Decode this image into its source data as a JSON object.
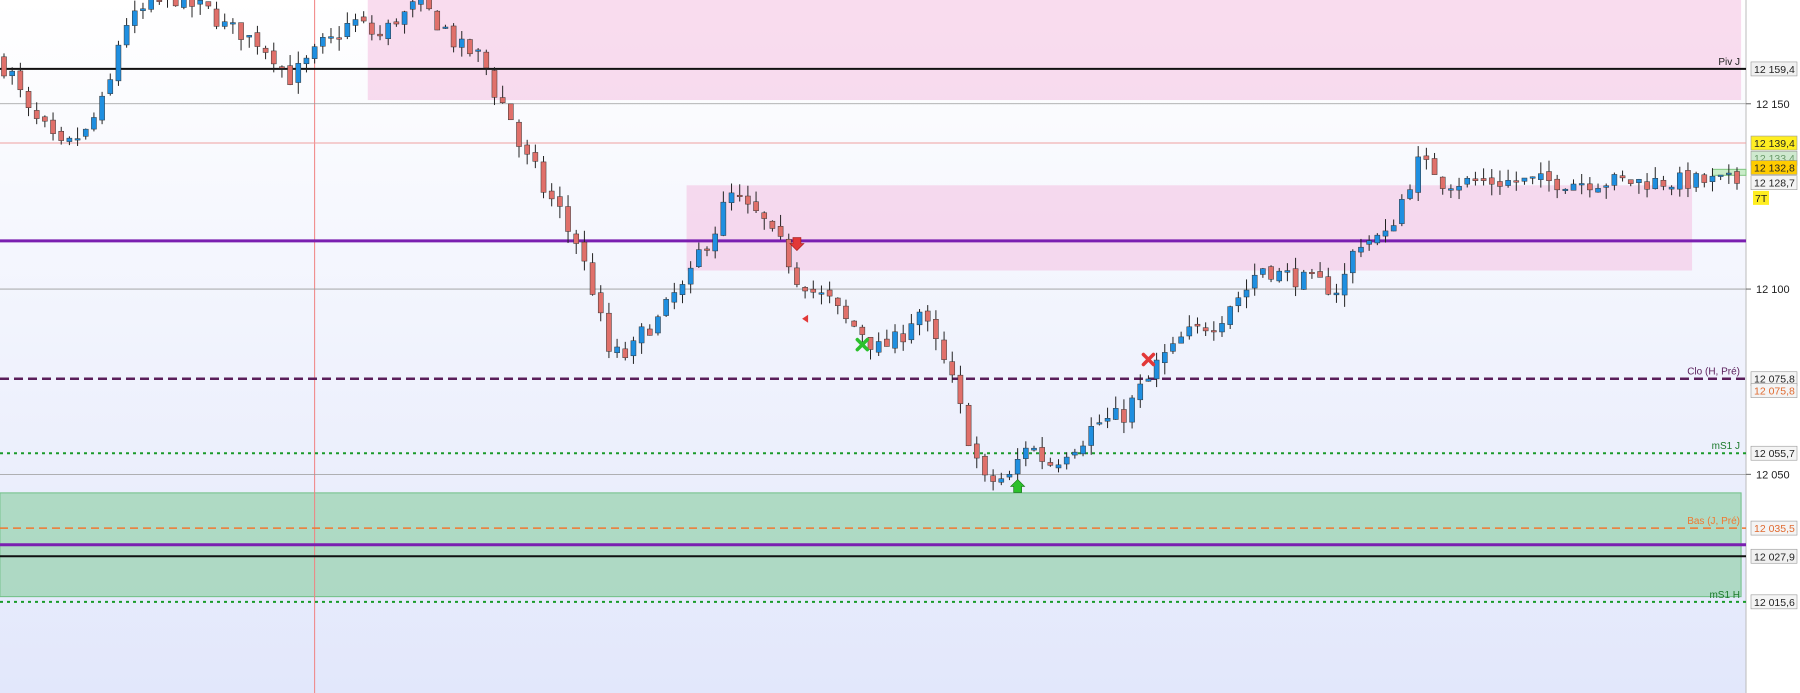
{
  "chart_data": {
    "type": "candlestick",
    "instrument_note": "",
    "y_range": [
      11991,
      12178
    ],
    "y_ticks": [
      12150,
      12100,
      12050
    ],
    "x_count": 213,
    "colors": {
      "up": "#1f8fe0",
      "down": "#e0706a",
      "pink_zone": "#f4bfe0",
      "green_zone": "#8fcfa6",
      "purple": "#7a1fb0",
      "dark_purple": "#5a1e5a",
      "orange": "#f07830",
      "green_dotted": "#1a9a2a",
      "background_top": "#ffffff",
      "background_bottom": "#e2e7fb"
    },
    "zones": [
      {
        "type": "pink",
        "x_from": 45,
        "x_to": 212,
        "y_top": 12178,
        "y_bottom": 12151
      },
      {
        "type": "pink",
        "x_from": 84,
        "x_to": 206,
        "y_top": 12128,
        "y_bottom": 12105
      },
      {
        "type": "green",
        "x_from": 0,
        "x_to": 212,
        "y_top": 12045,
        "y_bottom": 12017
      }
    ],
    "levels": [
      {
        "name": "Piv J",
        "value": 12159.4,
        "label": "12 159,4",
        "style": "black-solid",
        "tag_color": "#f0f0f0",
        "tag_text": "#222"
      },
      {
        "name": "",
        "value": 12150,
        "label": "",
        "style": "grid",
        "tag_color": null,
        "tag_text": null
      },
      {
        "name": "",
        "value": 12139.4,
        "label": "12 139,4",
        "style": "thin-red",
        "tag_color": "#ffee22",
        "tag_text": "#222"
      },
      {
        "name": "",
        "value": 12132.8,
        "label": "12 132,8",
        "style": "none",
        "tag_color": "#ffcc00",
        "tag_text": "#222"
      },
      {
        "name": "",
        "value": 12128.7,
        "label": "12 128,7",
        "style": "none",
        "tag_color": "#f4f4f4",
        "tag_text": "#222"
      },
      {
        "name": "",
        "value": 12113,
        "label": "",
        "style": "purple-thick",
        "tag_color": null,
        "tag_text": null
      },
      {
        "name": "",
        "value": 12100,
        "label": "",
        "style": "grid",
        "tag_color": null,
        "tag_text": null
      },
      {
        "name": "Clo (H, Pré)",
        "value": 12075.8,
        "label": "12 075,8",
        "style": "purple-dashed",
        "tag_color": "#f4f4f4",
        "tag_text": "#222"
      },
      {
        "name": "",
        "value": 12072.6,
        "label": "12 075,8",
        "style": "none",
        "tag_color": "#f4f4f4",
        "tag_text": "#e06a30"
      },
      {
        "name": "mS1 J",
        "value": 12055.7,
        "label": "12 055,7",
        "style": "green-dotted",
        "tag_color": "#f4f4f4",
        "tag_text": "#222"
      },
      {
        "name": "",
        "value": 12050,
        "label": "",
        "style": "grid",
        "tag_color": null,
        "tag_text": null
      },
      {
        "name": "Bas (J, Pré)",
        "value": 12035.5,
        "label": "12 035,5",
        "style": "orange-dashed",
        "tag_color": "#f4f4f4",
        "tag_text": "#e06a30"
      },
      {
        "name": "",
        "value": 12031,
        "label": "",
        "style": "purple-thick",
        "tag_color": null,
        "tag_text": null
      },
      {
        "name": "",
        "value": 12027.9,
        "label": "12 027,9",
        "style": "black-solid",
        "tag_color": "#f0f0f0",
        "tag_text": "#222"
      },
      {
        "name": "mS1 H",
        "value": 12015.6,
        "label": "12 015,6",
        "style": "green-dotted",
        "tag_color": "#f4f4f4",
        "tag_text": "#222"
      }
    ],
    "extra_tags": [
      {
        "text": "12 133,4",
        "value": 12135.3,
        "color": "#cfe9cf",
        "text_color": "#6a9a6a"
      },
      {
        "text": "7T",
        "value": 12124.6,
        "color": "#ffee22",
        "text_color": "#222"
      }
    ],
    "current_price_marker": {
      "value": 12131.5,
      "x_from": 209,
      "x_to": 212
    },
    "vertical_marker_x": 38,
    "signals": [
      {
        "type": "arrow-down",
        "x": 97,
        "value": 12112
      },
      {
        "type": "triangle-left",
        "x": 98,
        "value": 12092
      },
      {
        "type": "x-green",
        "x": 105,
        "value": 12085
      },
      {
        "type": "x-red",
        "x": 140,
        "value": 12081
      },
      {
        "type": "arrow-up",
        "x": 124,
        "value": 12047
      }
    ],
    "anchors": [
      [
        0,
        12160
      ],
      [
        4,
        12145
      ],
      [
        7,
        12138
      ],
      [
        10,
        12142
      ],
      [
        12,
        12150
      ],
      [
        15,
        12172
      ],
      [
        18,
        12176
      ],
      [
        20,
        12179
      ],
      [
        24,
        12176
      ],
      [
        28,
        12170
      ],
      [
        31,
        12167
      ],
      [
        33,
        12163
      ],
      [
        35,
        12157
      ],
      [
        37,
        12161
      ],
      [
        39,
        12166
      ],
      [
        43,
        12172
      ],
      [
        46,
        12168
      ],
      [
        48,
        12173
      ],
      [
        51,
        12177
      ],
      [
        53,
        12172
      ],
      [
        56,
        12165
      ],
      [
        58,
        12163
      ],
      [
        61,
        12150
      ],
      [
        64,
        12135
      ],
      [
        67,
        12124
      ],
      [
        70,
        12113
      ],
      [
        72,
        12100
      ],
      [
        74,
        12083
      ],
      [
        76,
        12082
      ],
      [
        79,
        12090
      ],
      [
        83,
        12100
      ],
      [
        86,
        12113
      ],
      [
        89,
        12125
      ],
      [
        92,
        12120
      ],
      [
        95,
        12112
      ],
      [
        97,
        12103
      ],
      [
        100,
        12098
      ],
      [
        104,
        12090
      ],
      [
        107,
        12084
      ],
      [
        109,
        12086
      ],
      [
        112,
        12094
      ],
      [
        114,
        12085
      ],
      [
        116,
        12075
      ],
      [
        118,
        12060
      ],
      [
        120,
        12048
      ],
      [
        123,
        12049
      ],
      [
        125,
        12058
      ],
      [
        128,
        12053
      ],
      [
        131,
        12058
      ],
      [
        134,
        12064
      ],
      [
        137,
        12066
      ],
      [
        139,
        12073
      ],
      [
        142,
        12082
      ],
      [
        145,
        12088
      ],
      [
        148,
        12091
      ],
      [
        151,
        12098
      ],
      [
        154,
        12106
      ],
      [
        156,
        12104
      ],
      [
        160,
        12102
      ],
      [
        163,
        12100
      ],
      [
        166,
        12113
      ],
      [
        169,
        12114
      ],
      [
        171,
        12124
      ],
      [
        173,
        12134
      ],
      [
        175,
        12132
      ],
      [
        176,
        12129
      ]
    ]
  }
}
